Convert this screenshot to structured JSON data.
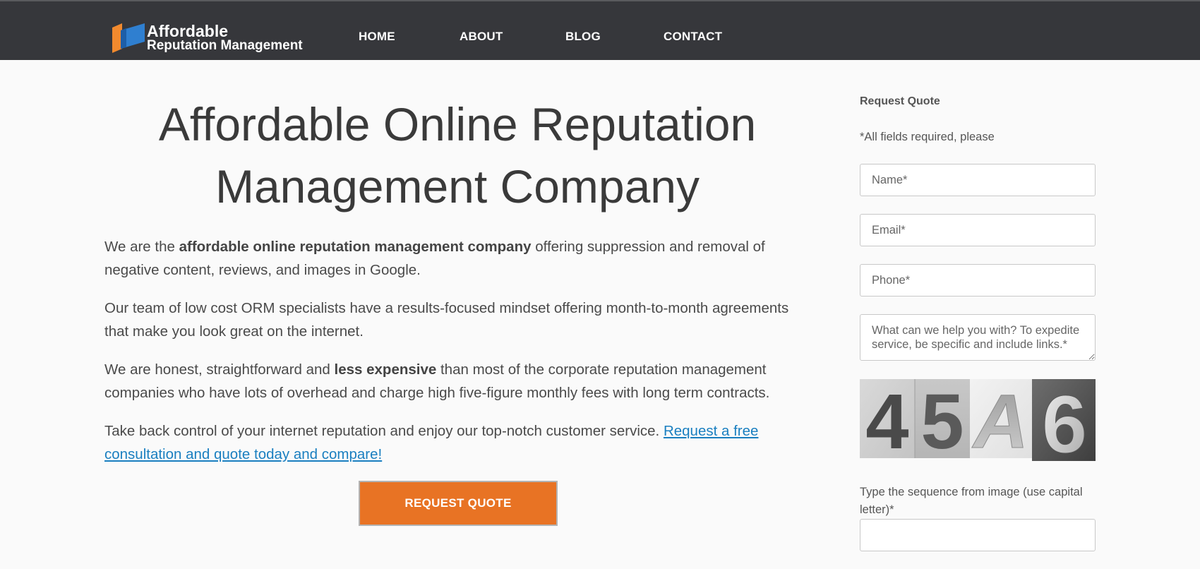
{
  "header": {
    "logo_line1": "Affordable",
    "logo_line2": "Reputation Management",
    "nav": [
      "HOME",
      "ABOUT",
      "BLOG",
      "CONTACT"
    ]
  },
  "main": {
    "title_line1": "Affordable Online Reputation",
    "title_line2": "Management Company",
    "p1_pre": "We are the ",
    "p1_bold": "affordable online reputation management company",
    "p1_post": " offering suppression and removal of negative content, reviews, and images in Google.",
    "p2": "Our team of low cost ORM specialists have a results-focused mindset offering month-to-month agreements that make you look great on the internet.",
    "p3_pre": "We are honest, straightforward and ",
    "p3_bold": "less expensive",
    "p3_post": " than most of the corporate reputation management companies who have lots of overhead and charge high five-figure monthly fees with long term contracts.",
    "p4_pre": "Take back control of your internet reputation and enjoy our top-notch customer service. ",
    "p4_link": "Request a free consultation and quote today and compare!",
    "cta_label": "REQUEST QUOTE"
  },
  "sidebar": {
    "title": "Request Quote",
    "note": "*All fields required, please",
    "name_placeholder": "Name*",
    "email_placeholder": "Email*",
    "phone_placeholder": "Phone*",
    "message_placeholder": "What can we help you with? To expedite service, be specific and include links.*",
    "captcha_chars": [
      "4",
      "5",
      "A",
      "6"
    ],
    "captcha_label": "Type the sequence from image (use capital letter)*"
  },
  "colors": {
    "header_bg": "#36373b",
    "accent_orange": "#e87324",
    "link_blue": "#1a7fc0",
    "logo_orange": "#f28a2e",
    "logo_blue": "#2f7fd0"
  }
}
